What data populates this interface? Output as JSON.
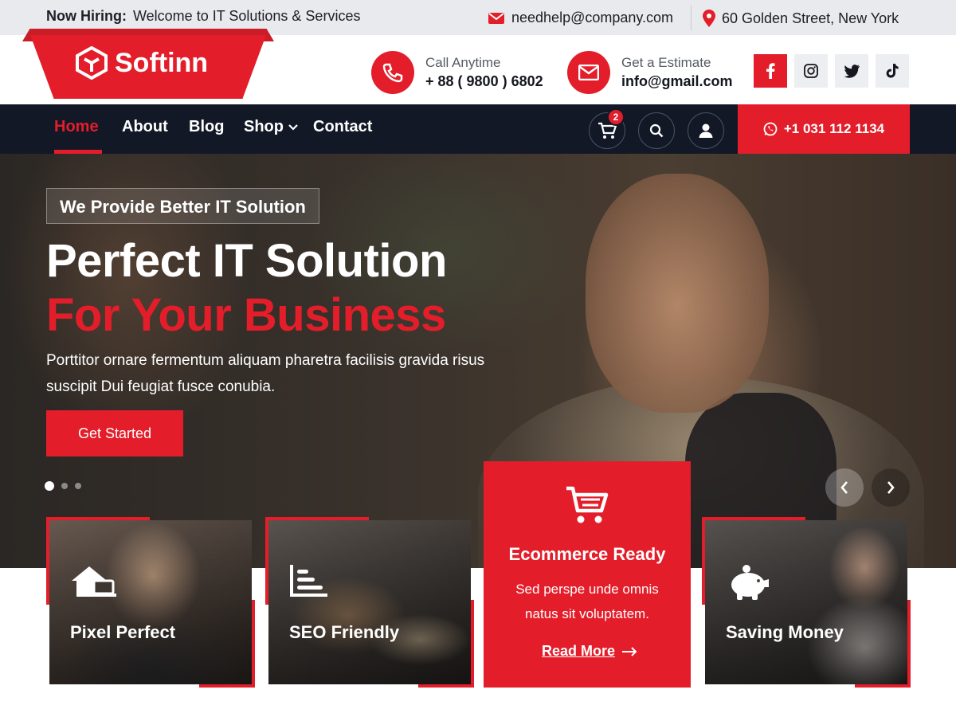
{
  "topbar": {
    "hiring_label": "Now Hiring:",
    "hiring_text": "Welcome to IT Solutions & Services",
    "email": "needhelp@company.com",
    "address": "60 Golden Street, New York"
  },
  "brand": {
    "name": "Softinn",
    "color": "#e31e2a",
    "dark": "#121826"
  },
  "header": {
    "call_label": "Call Anytime",
    "call_value": "+ 88 ( 9800 ) 6802",
    "estimate_label": "Get a Estimate",
    "estimate_value": "info@gmail.com",
    "social": [
      "facebook-icon",
      "instagram-icon",
      "twitter-icon",
      "tiktok-icon"
    ]
  },
  "nav": {
    "items": [
      {
        "label": "Home"
      },
      {
        "label": "About"
      },
      {
        "label": "Blog"
      },
      {
        "label": "Shop"
      },
      {
        "label": "Contact"
      }
    ],
    "cart_count": "2",
    "phone": "+1 031 112 1134"
  },
  "hero": {
    "badge": "We Provide Better IT Solution",
    "title_line1": "Perfect IT Solution",
    "title_line2": "For Your Business",
    "description": "Porttitor ornare fermentum aliquam pharetra facilisis gravida risus suscipit Dui feugiat fusce conubia.",
    "cta": "Get Started",
    "slide_count": 3,
    "active_slide": 1
  },
  "features": [
    {
      "title": "Pixel Perfect",
      "icon": "house-devices-icon"
    },
    {
      "title": "SEO Friendly",
      "icon": "bar-chart-icon"
    },
    {
      "title": "Ecommerce Ready",
      "icon": "cart-icon",
      "description": "Sed perspe unde omnis natus sit voluptatem.",
      "link": "Read More"
    },
    {
      "title": "Saving Money",
      "icon": "piggy-bank-icon"
    }
  ]
}
